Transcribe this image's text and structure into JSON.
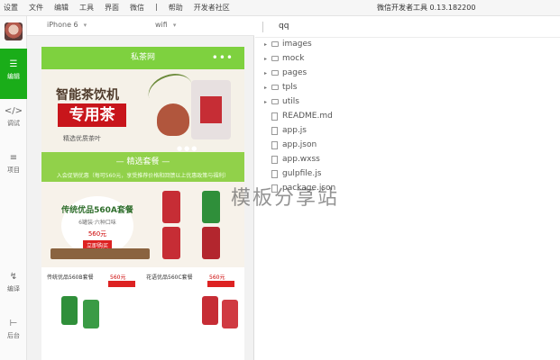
{
  "menubar": {
    "items": [
      "设置",
      "文件",
      "编辑",
      "工具",
      "界面",
      "微信",
      "|",
      "帮助",
      "开发者社区"
    ],
    "title": "微信开发者工具 0.13.182200"
  },
  "sidebar": {
    "items": [
      {
        "label": "编辑",
        "icon": "editor-icon"
      },
      {
        "label": "调试",
        "icon": "code-icon"
      },
      {
        "label": "项目",
        "icon": "menu-lines-icon"
      },
      {
        "label": "编译",
        "icon": "compile-icon"
      },
      {
        "label": "后台",
        "icon": "backend-icon"
      }
    ]
  },
  "simulator": {
    "device": "iPhone 6",
    "network": "wifi"
  },
  "phone": {
    "nav_title": "私茶网",
    "nav_dots": "•••",
    "banner": {
      "title": "智能茶饮机",
      "highlight": "专用茶",
      "subtitle": "精选优质茶叶"
    },
    "section_title": "— 精选套餐 —",
    "section_desc": "入会促销优惠（每可560元，享受推荐价格和回馈以上优惠政策与福利）",
    "promo": {
      "title": "传统优品560A套餐",
      "subtitle": "6罐装·六种口味",
      "price": "560元",
      "badge": "立即购买"
    },
    "cards": [
      {
        "name": "传统优品560B套餐",
        "price": "560元"
      },
      {
        "name": "花语优品560C套餐",
        "price": "560元"
      }
    ]
  },
  "explorer": {
    "project": "qq",
    "tree": [
      {
        "name": "images",
        "type": "folder"
      },
      {
        "name": "mock",
        "type": "folder"
      },
      {
        "name": "pages",
        "type": "folder"
      },
      {
        "name": "tpls",
        "type": "folder"
      },
      {
        "name": "utils",
        "type": "folder"
      },
      {
        "name": "README.md",
        "type": "file"
      },
      {
        "name": "app.js",
        "type": "file"
      },
      {
        "name": "app.json",
        "type": "file"
      },
      {
        "name": "app.wxss",
        "type": "file"
      },
      {
        "name": "gulpfile.js",
        "type": "file"
      },
      {
        "name": "package.json",
        "type": "file"
      }
    ]
  },
  "watermark": "模板分享站",
  "colors": {
    "accent_green": "#1aad19",
    "nav_green": "#7ed13f",
    "band_green": "#91d14a",
    "brand_red": "#c8151b"
  }
}
